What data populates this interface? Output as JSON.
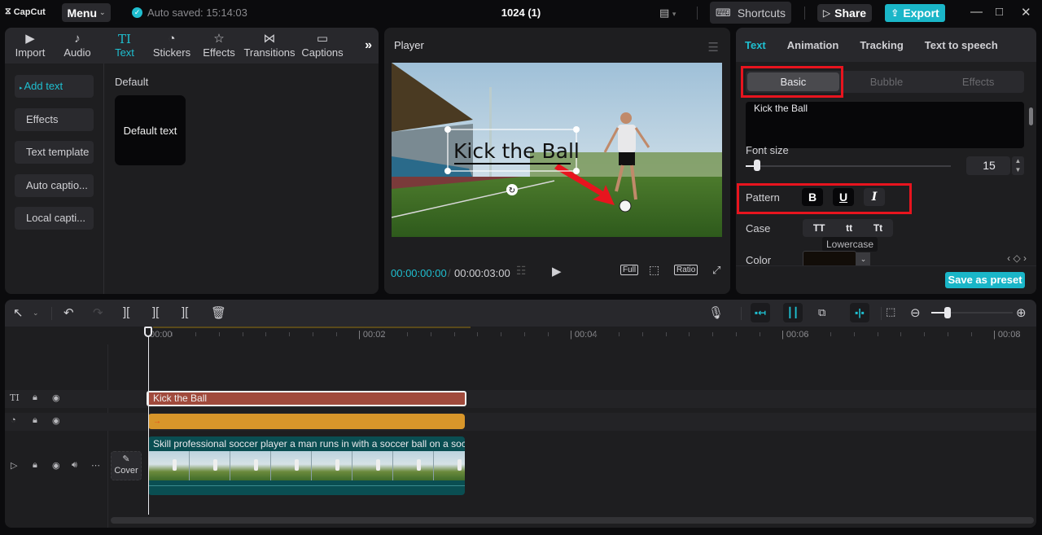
{
  "app": {
    "logo": "CapCut",
    "menu_label": "Menu",
    "autosave": "Auto saved: 15:14:03",
    "project_title": "1024 (1)",
    "shortcuts_label": "Shortcuts",
    "share_label": "Share",
    "export_label": "Export",
    "accent_color": "#1fbfd0"
  },
  "media_tabs": [
    {
      "label": "Import",
      "icon": "import-icon"
    },
    {
      "label": "Audio",
      "icon": "audio-icon"
    },
    {
      "label": "Text",
      "icon": "text-icon",
      "active": true
    },
    {
      "label": "Stickers",
      "icon": "sticker-icon"
    },
    {
      "label": "Effects",
      "icon": "effects-icon"
    },
    {
      "label": "Transitions",
      "icon": "transitions-icon"
    },
    {
      "label": "Captions",
      "icon": "captions-icon"
    }
  ],
  "text_nav": [
    {
      "label": "Add text",
      "active": true
    },
    {
      "label": "Effects"
    },
    {
      "label": "Text template"
    },
    {
      "label": "Auto captio..."
    },
    {
      "label": "Local capti..."
    }
  ],
  "text_library": {
    "section_label": "Default",
    "card_label": "Default text"
  },
  "player": {
    "title": "Player",
    "overlay_text": "Kick the Ball",
    "current_time": "00:00:00:00",
    "total_time": "00:00:03:00",
    "full_label": "Full",
    "ratio_label": "Ratio"
  },
  "inspector": {
    "tabs": [
      {
        "label": "Text",
        "active": true
      },
      {
        "label": "Animation"
      },
      {
        "label": "Tracking"
      },
      {
        "label": "Text to speech"
      }
    ],
    "subtabs": [
      {
        "label": "Basic",
        "active": true
      },
      {
        "label": "Bubble"
      },
      {
        "label": "Effects"
      }
    ],
    "text_value": "Kick the Ball",
    "font_size_label": "Font size",
    "font_size_value": "15",
    "font_size_slider_fraction": 0.04,
    "pattern_label": "Pattern",
    "pattern_buttons": [
      "B",
      "U",
      "I"
    ],
    "case_label": "Case",
    "case_buttons": [
      "TT",
      "tt",
      "Tt"
    ],
    "case_tooltip": "Lowercase",
    "color_label": "Color",
    "color_value": "#120d08",
    "save_preset_label": "Save as preset"
  },
  "timeline": {
    "ruler_labels": [
      "00:00",
      "00:02",
      "00:04",
      "00:06",
      "00:08"
    ],
    "zoom_fraction": 0.2,
    "tracks": {
      "text_clip": "Kick the Ball",
      "effect_clip": "→",
      "video_clip_caption": "Skill professional soccer player a man runs in with a soccer ball on a soccer field",
      "cover_label": "Cover"
    }
  }
}
